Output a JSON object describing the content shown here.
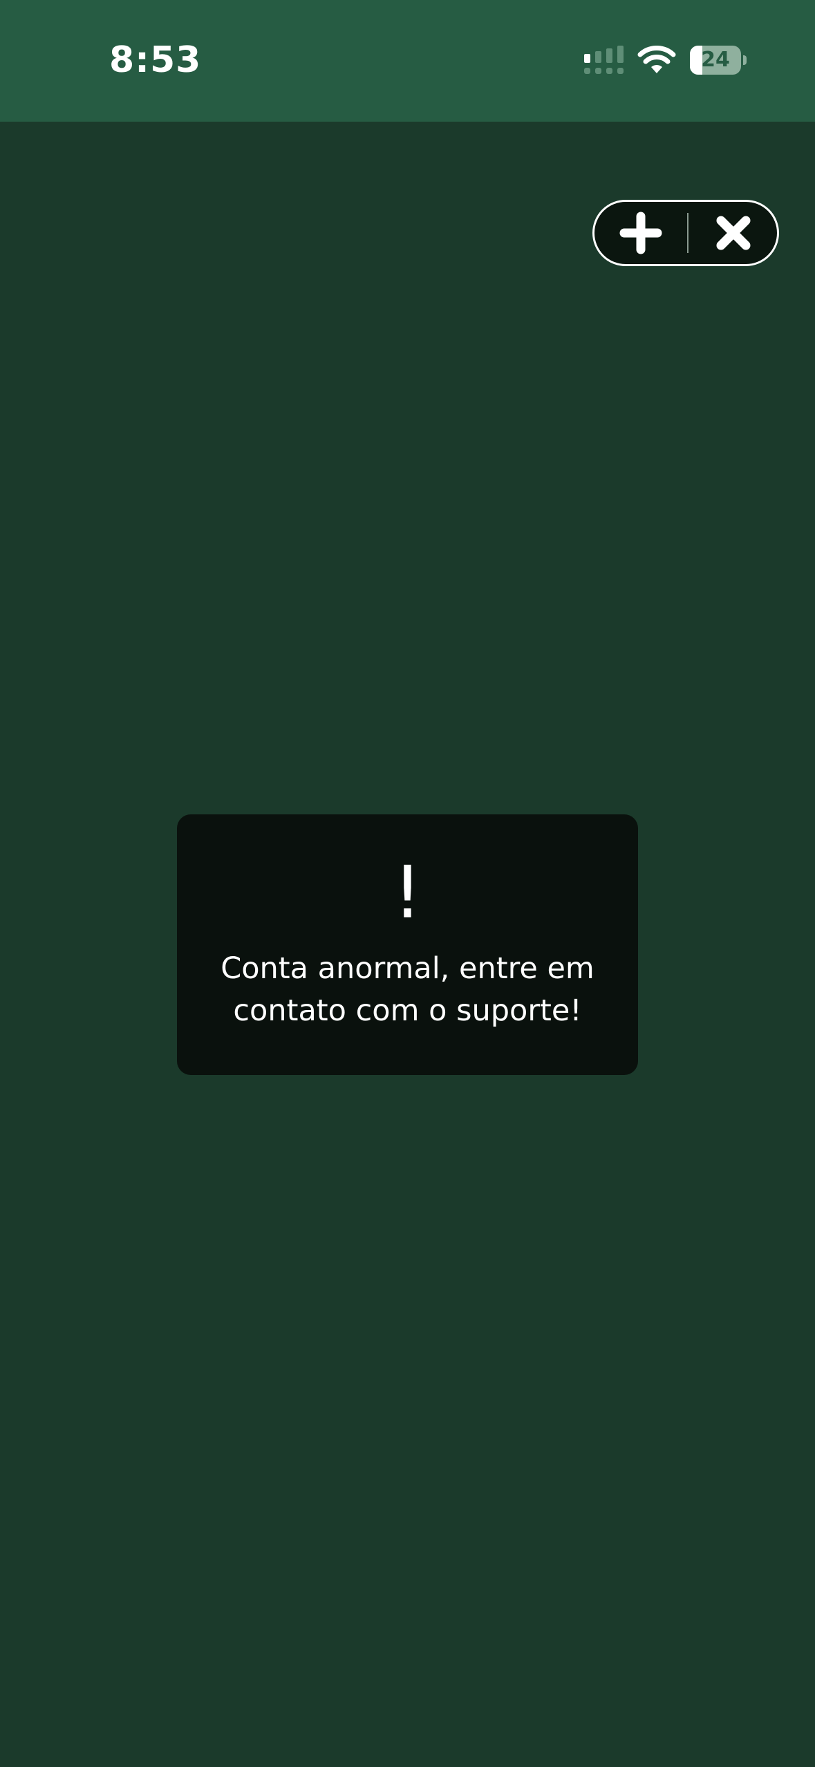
{
  "status_bar": {
    "time": "8:53",
    "battery_level": "24",
    "battery_fraction": 0.24,
    "signal_icon": "cellular-signal-icon",
    "wifi_icon": "wifi-icon",
    "battery_icon": "battery-icon"
  },
  "capsule": {
    "add_icon": "plus-icon",
    "close_icon": "close-icon"
  },
  "toast": {
    "icon": "!",
    "message": "Conta anormal, entre em contato com o suporte!"
  },
  "colors": {
    "status_bar_bg": "#265c43",
    "page_bg": "#1b3a2b",
    "toast_bg": "#0a110d",
    "text": "#ffffff"
  }
}
